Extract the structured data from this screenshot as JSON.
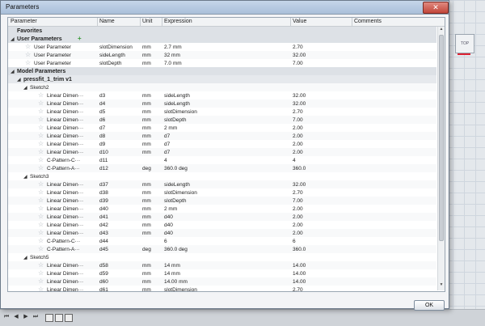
{
  "window": {
    "title": "Parameters",
    "close_glyph": "✕"
  },
  "columns": {
    "parameter": "Parameter",
    "name": "Name",
    "unit": "Unit",
    "expression": "Expression",
    "value": "Value",
    "comments": "Comments"
  },
  "rows": [
    {
      "type": "section",
      "label": "Favorites",
      "expander": ""
    },
    {
      "type": "section",
      "label": "User Parameters",
      "expander": "◢",
      "plus": true
    },
    {
      "type": "param",
      "indent": 1,
      "label": "User Parameter",
      "name": "slotDimension",
      "unit": "mm",
      "expr": "2.7 mm",
      "value": "2.70"
    },
    {
      "type": "param",
      "indent": 1,
      "label": "User Parameter",
      "name": "sideLength",
      "unit": "mm",
      "expr": "32 mm",
      "value": "32.00"
    },
    {
      "type": "param",
      "indent": 1,
      "label": "User Parameter",
      "name": "slotDepth",
      "unit": "mm",
      "expr": "7.0 mm",
      "value": "7.00"
    },
    {
      "type": "section",
      "label": "Model Parameters",
      "expander": "◢"
    },
    {
      "type": "subsection",
      "indent": 1,
      "label": "pressfit_1_trim v1",
      "expander": "◢"
    },
    {
      "type": "group",
      "indent": 2,
      "label": "Sketch2",
      "expander": "◢"
    },
    {
      "type": "param",
      "indent": 3,
      "label": "Linear Dimen···",
      "name": "d3",
      "unit": "mm",
      "expr": "sideLength",
      "value": "32.00"
    },
    {
      "type": "param",
      "indent": 3,
      "label": "Linear Dimen···",
      "name": "d4",
      "unit": "mm",
      "expr": "sideLength",
      "value": "32.00"
    },
    {
      "type": "param",
      "indent": 3,
      "label": "Linear Dimen···",
      "name": "d5",
      "unit": "mm",
      "expr": "slotDimension",
      "value": "2.70"
    },
    {
      "type": "param",
      "indent": 3,
      "label": "Linear Dimen···",
      "name": "d6",
      "unit": "mm",
      "expr": "slotDepth",
      "value": "7.00"
    },
    {
      "type": "param",
      "indent": 3,
      "label": "Linear Dimen···",
      "name": "d7",
      "unit": "mm",
      "expr": "2 mm",
      "value": "2.00"
    },
    {
      "type": "param",
      "indent": 3,
      "label": "Linear Dimen···",
      "name": "d8",
      "unit": "mm",
      "expr": "d7",
      "value": "2.00"
    },
    {
      "type": "param",
      "indent": 3,
      "label": "Linear Dimen···",
      "name": "d9",
      "unit": "mm",
      "expr": "d7",
      "value": "2.00"
    },
    {
      "type": "param",
      "indent": 3,
      "label": "Linear Dimen···",
      "name": "d10",
      "unit": "mm",
      "expr": "d7",
      "value": "2.00"
    },
    {
      "type": "param",
      "indent": 3,
      "label": "C-Pattern-C···",
      "name": "d11",
      "unit": "",
      "expr": "4",
      "value": "4"
    },
    {
      "type": "param",
      "indent": 3,
      "label": "C-Pattern-A···",
      "name": "d12",
      "unit": "deg",
      "expr": "360.0 deg",
      "value": "360.0"
    },
    {
      "type": "group",
      "indent": 2,
      "label": "Sketch3",
      "expander": "◢"
    },
    {
      "type": "param",
      "indent": 3,
      "label": "Linear Dimen···",
      "name": "d37",
      "unit": "mm",
      "expr": "sideLength",
      "value": "32.00"
    },
    {
      "type": "param",
      "indent": 3,
      "label": "Linear Dimen···",
      "name": "d38",
      "unit": "mm",
      "expr": "slotDimension",
      "value": "2.70"
    },
    {
      "type": "param",
      "indent": 3,
      "label": "Linear Dimen···",
      "name": "d39",
      "unit": "mm",
      "expr": "slotDepth",
      "value": "7.00"
    },
    {
      "type": "param",
      "indent": 3,
      "label": "Linear Dimen···",
      "name": "d40",
      "unit": "mm",
      "expr": "2 mm",
      "value": "2.00"
    },
    {
      "type": "param",
      "indent": 3,
      "label": "Linear Dimen···",
      "name": "d41",
      "unit": "mm",
      "expr": "d40",
      "value": "2.00"
    },
    {
      "type": "param",
      "indent": 3,
      "label": "Linear Dimen···",
      "name": "d42",
      "unit": "mm",
      "expr": "d40",
      "value": "2.00"
    },
    {
      "type": "param",
      "indent": 3,
      "label": "Linear Dimen···",
      "name": "d43",
      "unit": "mm",
      "expr": "d40",
      "value": "2.00"
    },
    {
      "type": "param",
      "indent": 3,
      "label": "C-Pattern-C···",
      "name": "d44",
      "unit": "",
      "expr": "6",
      "value": "6"
    },
    {
      "type": "param",
      "indent": 3,
      "label": "C-Pattern-A···",
      "name": "d45",
      "unit": "deg",
      "expr": "360.0 deg",
      "value": "360.0"
    },
    {
      "type": "group",
      "indent": 2,
      "label": "Sketch5",
      "expander": "◢"
    },
    {
      "type": "param",
      "indent": 3,
      "label": "Linear Dimen···",
      "name": "d58",
      "unit": "mm",
      "expr": "14 mm",
      "value": "14.00"
    },
    {
      "type": "param",
      "indent": 3,
      "label": "Linear Dimen···",
      "name": "d59",
      "unit": "mm",
      "expr": "14 mm",
      "value": "14.00"
    },
    {
      "type": "param",
      "indent": 3,
      "label": "Linear Dimen···",
      "name": "d60",
      "unit": "mm",
      "expr": "14.00 mm",
      "value": "14.00"
    },
    {
      "type": "param",
      "indent": 3,
      "label": "Linear Dimen···",
      "name": "d61",
      "unit": "mm",
      "expr": "slotDimension",
      "value": "2.70"
    }
  ],
  "buttons": {
    "ok": "OK"
  },
  "viewcube": {
    "label": "TOP"
  },
  "scrollbar": {
    "up": "▲",
    "down": "▼"
  },
  "timeline": {
    "controls": [
      "⏮",
      "◀",
      "▶",
      "⏭"
    ]
  },
  "icons": {
    "star": "☆",
    "plus": "+"
  }
}
